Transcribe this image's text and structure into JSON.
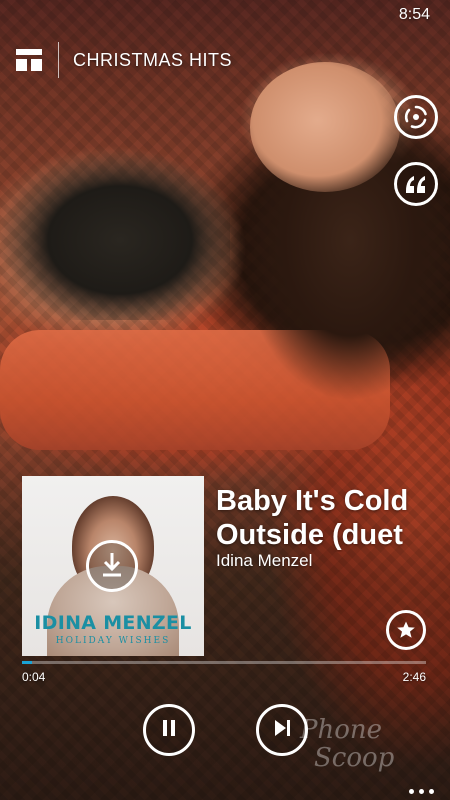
{
  "status_bar": {
    "time": "8:54"
  },
  "header": {
    "title": "CHRISTMAS HITS",
    "menu_icon": "collection-icon"
  },
  "side_actions": [
    {
      "name": "smart-dj-button",
      "icon": "mix-icon"
    },
    {
      "name": "quote-button",
      "icon": "quote-icon"
    }
  ],
  "album": {
    "artist_text": "IDINA MENZEL",
    "album_text": "HOLIDAY WISHES",
    "download_icon": "download-icon"
  },
  "track": {
    "title": "Baby It's Cold Outside (duet",
    "artist": "Idina Menzel"
  },
  "favorite_icon": "star-icon",
  "progress": {
    "elapsed": "0:04",
    "total": "2:46",
    "fraction": 0.024,
    "color": "#1aa3d6"
  },
  "controls": {
    "pause_icon": "pause-icon",
    "next_icon": "skip-next-icon"
  },
  "watermark": {
    "line1": "Phone",
    "line2": "Scoop"
  },
  "more_icon": "more-dots-icon"
}
